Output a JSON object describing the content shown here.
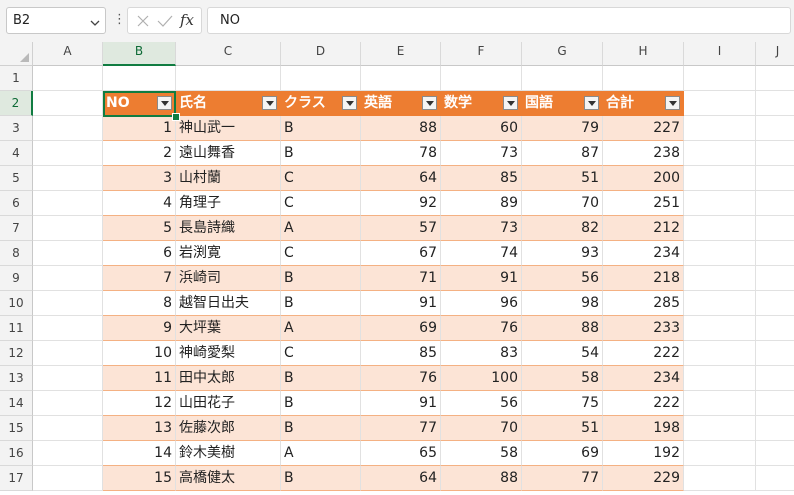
{
  "formula_bar": {
    "name_box": "B2",
    "formula": "NO",
    "fx_label": "fx"
  },
  "columns": [
    "A",
    "B",
    "C",
    "D",
    "E",
    "F",
    "G",
    "H",
    "I",
    "J"
  ],
  "selected_column": "B",
  "selected_row": 2,
  "table": {
    "style_colors": {
      "header": "#ed7d31",
      "band": "#fce4d6",
      "active": "#107c41"
    },
    "headers": [
      "NO",
      "氏名",
      "クラス",
      "英語",
      "数学",
      "国語",
      "合計"
    ],
    "rows": [
      [
        1,
        "神山武一",
        "B",
        88,
        60,
        79,
        227
      ],
      [
        2,
        "遠山舞香",
        "B",
        78,
        73,
        87,
        238
      ],
      [
        3,
        "山村蘭",
        "C",
        64,
        85,
        51,
        200
      ],
      [
        4,
        "角理子",
        "C",
        92,
        89,
        70,
        251
      ],
      [
        5,
        "長島詩織",
        "A",
        57,
        73,
        82,
        212
      ],
      [
        6,
        "岩渕寛",
        "C",
        67,
        74,
        93,
        234
      ],
      [
        7,
        "浜崎司",
        "B",
        71,
        91,
        56,
        218
      ],
      [
        8,
        "越智日出夫",
        "B",
        91,
        96,
        98,
        285
      ],
      [
        9,
        "大坪葉",
        "A",
        69,
        76,
        88,
        233
      ],
      [
        10,
        "神崎愛梨",
        "C",
        85,
        83,
        54,
        222
      ],
      [
        11,
        "田中太郎",
        "B",
        76,
        100,
        58,
        234
      ],
      [
        12,
        "山田花子",
        "B",
        91,
        56,
        75,
        222
      ],
      [
        13,
        "佐藤次郎",
        "B",
        77,
        70,
        51,
        198
      ],
      [
        14,
        "鈴木美樹",
        "A",
        65,
        58,
        69,
        192
      ],
      [
        15,
        "高橋健太",
        "B",
        64,
        88,
        77,
        229
      ]
    ]
  }
}
